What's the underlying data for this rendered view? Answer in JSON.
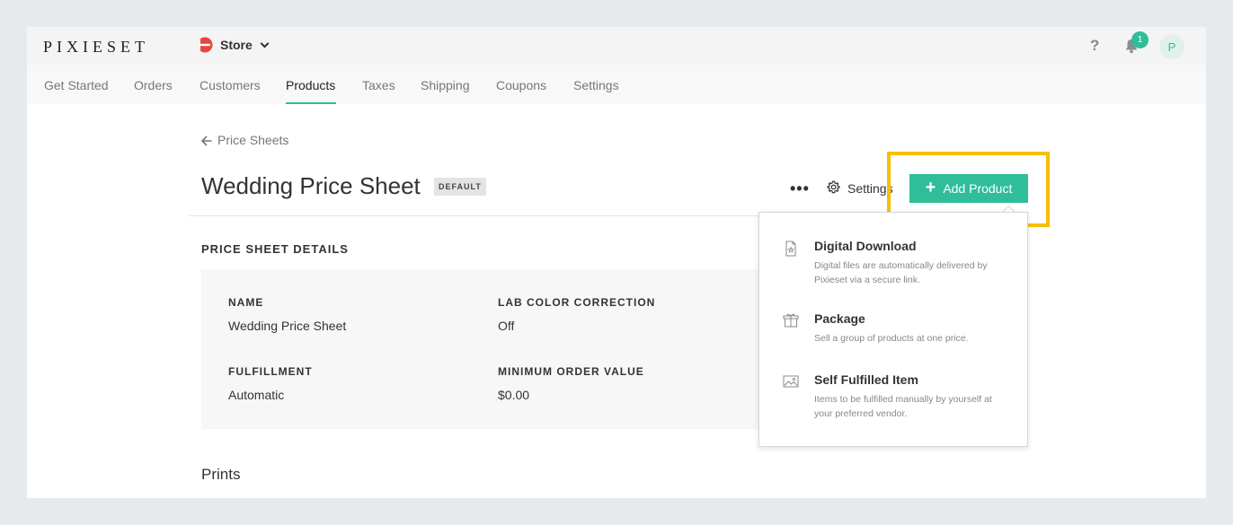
{
  "app": {
    "logo": "PIXIESET",
    "store_label": "Store",
    "help_label": "?",
    "notification_count": "1",
    "avatar_initial": "P",
    "accent_color": "#2fbd9a"
  },
  "nav": {
    "tabs": [
      {
        "label": "Get Started"
      },
      {
        "label": "Orders"
      },
      {
        "label": "Customers"
      },
      {
        "label": "Products",
        "active": true
      },
      {
        "label": "Taxes"
      },
      {
        "label": "Shipping"
      },
      {
        "label": "Coupons"
      },
      {
        "label": "Settings"
      }
    ]
  },
  "page": {
    "back_label": "Price Sheets",
    "title": "Wedding Price Sheet",
    "badge": "DEFAULT",
    "more_label": "•••",
    "settings_label": "Settings",
    "add_label": "Add Product",
    "add_plus": "+",
    "section_title": "PRICE SHEET DETAILS",
    "details": {
      "name_label": "NAME",
      "name_value": "Wedding Price Sheet",
      "lab_label": "LAB COLOR CORRECTION",
      "lab_value": "Off",
      "fulfillment_label": "FULFILLMENT",
      "fulfillment_value": "Automatic",
      "min_order_label": "MINIMUM ORDER VALUE",
      "min_order_value": "$0.00"
    },
    "prints_heading": "Prints"
  },
  "dropdown": {
    "items": [
      {
        "icon": "document-icon",
        "title": "Digital Download",
        "desc": "Digital files are automatically delivered by Pixieset via a secure link."
      },
      {
        "icon": "box-icon",
        "title": "Package",
        "desc": "Sell a group of products at one price."
      },
      {
        "icon": "image-icon",
        "title": "Self Fulfilled Item",
        "desc": "Items to be fulfilled manually by yourself at your preferred vendor."
      }
    ]
  }
}
